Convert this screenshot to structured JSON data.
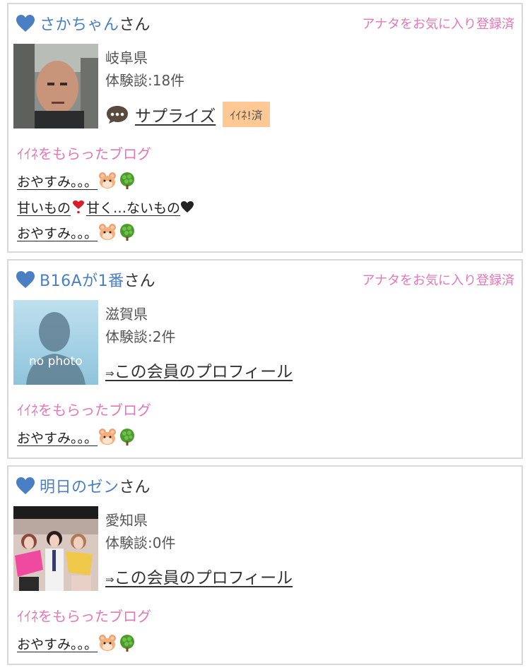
{
  "colors": {
    "link_blue": "#4a7fc4",
    "pink": "#e477b6",
    "iine_bg": "#ffc894",
    "border": "#d9d9d9"
  },
  "members": [
    {
      "name": "さかちゃん",
      "suffix": "さん",
      "favorite": "アナタをお気に入り登録済",
      "prefecture": "岐阜県",
      "experience": "体験談:18件",
      "action_label": "サプライズ",
      "iine_badge": "ｲｲﾈ!済",
      "section_title": "ｲｲﾈをもらったブログ",
      "blogs": [
        "おやすみ。。。",
        "甘いもの",
        "甘く…ないもの",
        "おやすみ。。。"
      ]
    },
    {
      "name": "B16Aが1番",
      "suffix": "さん",
      "favorite": "アナタをお気に入り登録済",
      "prefecture": "滋賀県",
      "experience": "体験談:2件",
      "profile_arrow": "⇒",
      "profile_link": "この会員のプロフィール",
      "photo_caption": "no photo",
      "section_title": "ｲｲﾈをもらったブログ",
      "blogs": [
        "おやすみ。。。"
      ]
    },
    {
      "name": "明日のゼン",
      "suffix": "さん",
      "prefecture": "愛知県",
      "experience": "体験談:0件",
      "profile_arrow": "⇒",
      "profile_link": "この会員のプロフィール",
      "section_title": "ｲｲﾈをもらったブログ",
      "blogs": [
        "おやすみ。。。"
      ]
    }
  ]
}
